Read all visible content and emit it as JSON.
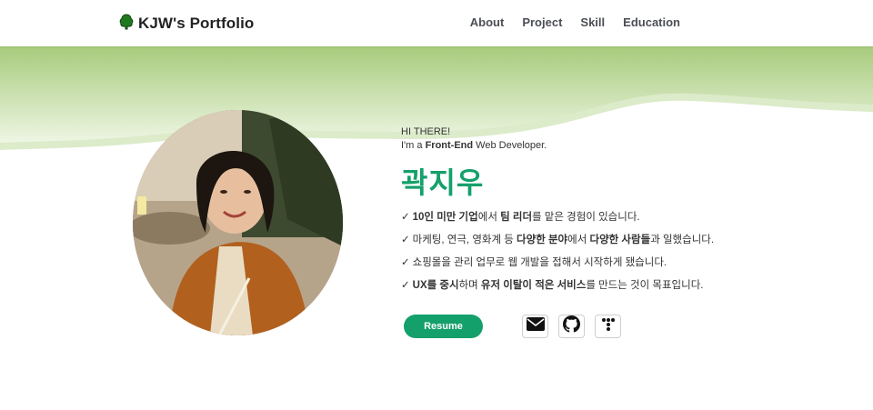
{
  "header": {
    "logo_text": "KJW's Portfolio",
    "nav": [
      {
        "label": "About"
      },
      {
        "label": "Project"
      },
      {
        "label": "Skill"
      },
      {
        "label": "Education"
      }
    ]
  },
  "hero": {
    "greeting": "HI THERE!",
    "role_prefix": "I'm a ",
    "role_highlight": "Front-End",
    "role_suffix": " Web Developer.",
    "name": "곽지우",
    "check_mark": "✓",
    "bullets": [
      {
        "parts": [
          {
            "t": "10인 미만 기업",
            "b": true
          },
          {
            "t": "에서 ",
            "b": false
          },
          {
            "t": "팀 리더",
            "b": true
          },
          {
            "t": "를 맡은 경험이 있습니다.",
            "b": false
          }
        ]
      },
      {
        "parts": [
          {
            "t": "마케팅, 연극, 영화계 등 ",
            "b": false
          },
          {
            "t": "다양한 분야",
            "b": true
          },
          {
            "t": "에서 ",
            "b": false
          },
          {
            "t": "다양한 사람들",
            "b": true
          },
          {
            "t": "과 일했습니다.",
            "b": false
          }
        ]
      },
      {
        "parts": [
          {
            "t": "쇼핑몰을 관리 업무로 웹 개발을 접해서 시작하게 됐습니다.",
            "b": false
          }
        ]
      },
      {
        "parts": [
          {
            "t": "UX를 중시",
            "b": true
          },
          {
            "t": "하며 ",
            "b": false
          },
          {
            "t": "유저 이탈이 적은 서비스",
            "b": true
          },
          {
            "t": "를 만드는 것이 목표입니다.",
            "b": false
          }
        ]
      }
    ],
    "resume_label": "Resume",
    "social": [
      "mail-icon",
      "github-icon",
      "tistory-icon"
    ]
  },
  "colors": {
    "accent": "#14a06b",
    "wave_top": "#a9cc7f",
    "wave_bottom": "#e8f2dc"
  }
}
